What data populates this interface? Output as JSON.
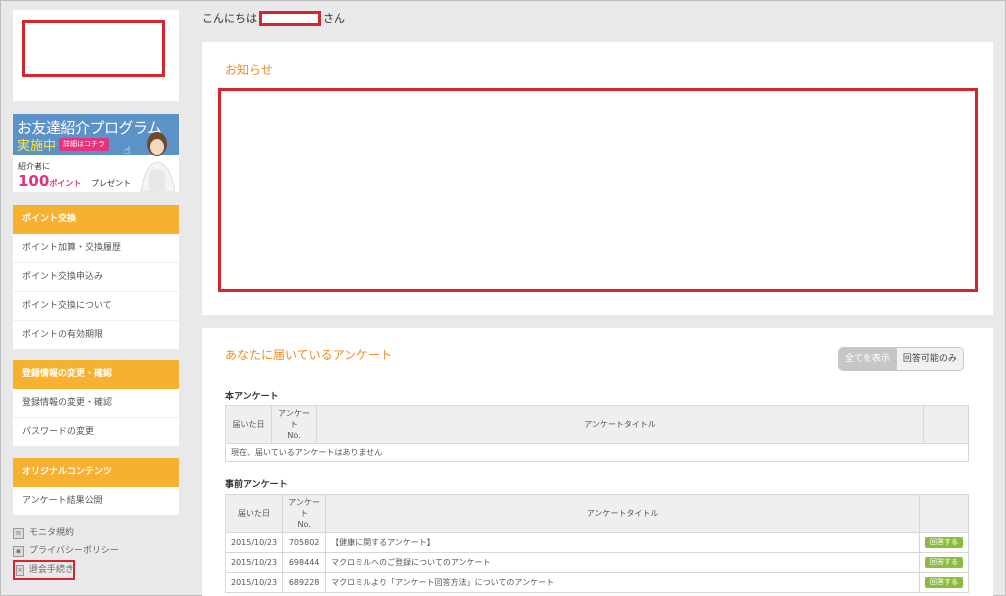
{
  "header": {
    "greeting_prefix": "こんにちは",
    "greeting_suffix": "さん"
  },
  "sidebar": {
    "banner": {
      "title": "お友達紹介プログラム",
      "subtitle": "実施中",
      "detail_button": "詳細はコチラ",
      "note": "紹介者に",
      "points_number": "100",
      "points_unit": "ポイント",
      "present": "プレゼント"
    },
    "sections": [
      {
        "heading": "ポイント交換",
        "items": [
          "ポイント加算・交換履歴",
          "ポイント交換申込み",
          "ポイント交換について",
          "ポイントの有効期限"
        ]
      },
      {
        "heading": "登録情報の変更・確認",
        "items": [
          "登録情報の変更・確認",
          "パスワードの変更"
        ]
      },
      {
        "heading": "オリジナルコンテンツ",
        "items": [
          "アンケート結果公開"
        ]
      }
    ],
    "footer_links": [
      "モニタ規約",
      "プライバシーポリシー",
      "退会手続き"
    ]
  },
  "notice": {
    "title": "お知らせ"
  },
  "surveys": {
    "title": "あなたに届いているアンケート",
    "toggle": {
      "show_all": "全てを表示",
      "answerable_only": "回答可能のみ",
      "selected": "show_all"
    },
    "main_section": {
      "title": "本アンケート",
      "columns": [
        "届いた日",
        "アンケート\nNo.",
        "アンケートタイトル",
        ""
      ],
      "empty_message": "現在、届いているアンケートはありません"
    },
    "pre_section": {
      "title": "事前アンケート",
      "columns": [
        "届いた日",
        "アンケート\nNo.",
        "アンケートタイトル",
        ""
      ],
      "rows": [
        {
          "date": "2015/10/23",
          "no": "705802",
          "title": "【健康に関するアンケート】",
          "action": "回答する"
        },
        {
          "date": "2015/10/23",
          "no": "698444",
          "title": "マクロミルへのご登録についてのアンケート",
          "action": "回答する"
        },
        {
          "date": "2015/10/23",
          "no": "689228",
          "title": "マクロミルより「アンケート回答方法」についてのアンケート",
          "action": "回答する"
        }
      ]
    }
  },
  "colors": {
    "accent_orange": "#f08c23",
    "menu_header": "#f7b132",
    "banner_blue": "#5b93c9",
    "answer_green": "#8dbd3e",
    "redaction_red": "#d6262d"
  }
}
